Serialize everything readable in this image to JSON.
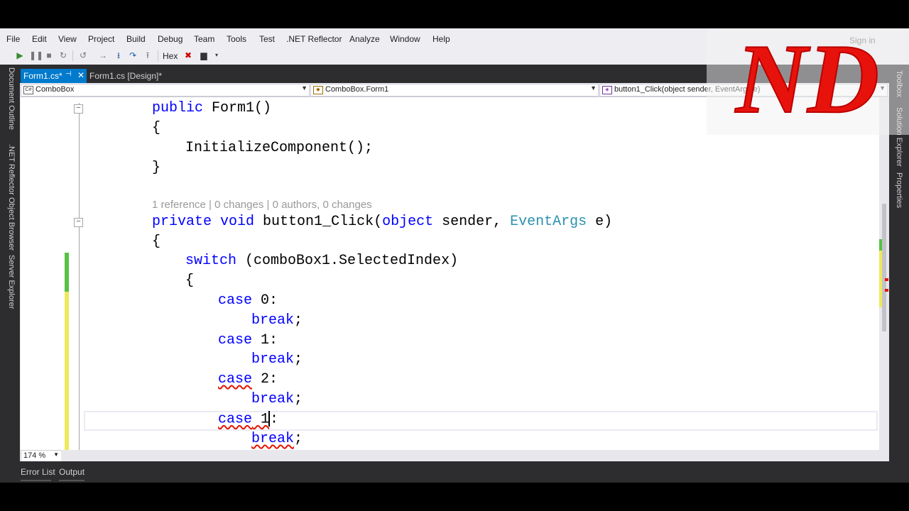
{
  "menu": [
    "File",
    "Edit",
    "View",
    "Project",
    "Build",
    "Debug",
    "Team",
    "Tools",
    "Test",
    ".NET Reflector",
    "Analyze",
    "Window",
    "Help"
  ],
  "account": {
    "signin": "Sign in"
  },
  "toolbar": {
    "hex": "Hex"
  },
  "tabs": {
    "active": "Form1.cs*",
    "inactive": "Form1.cs [Design]*"
  },
  "left_tools": [
    "Document Outline",
    ".NET Reflector Object Browser",
    "Server Explorer"
  ],
  "right_tools": [
    "Toolbox",
    "Solution Explorer",
    "Properties"
  ],
  "navbar": {
    "project": "ComboBox",
    "class": "ComboBox.Form1",
    "member": "button1_Click(object sender, EventArgs e)"
  },
  "code": {
    "l1_kw": "public",
    "l1_rest": " Form1()",
    "l2": "{",
    "l3": "InitializeComponent();",
    "l4": "}",
    "codelens": "1 reference | 0 changes | 0 authors, 0 changes",
    "l5_kw1": "private",
    "l5_kw2": "void",
    "l5_mid": " button1_Click(",
    "l5_kw3": "object",
    "l5_mid2": " sender, ",
    "l5_type": "EventArgs",
    "l5_end": " e)",
    "l6": "{",
    "l7_kw": "switch",
    "l7_rest": " (comboBox1.SelectedIndex)",
    "l8": "{",
    "case_kw": "case",
    "case0": " 0:",
    "case1": " 1:",
    "case2": " 2:",
    "case3_num": " 1",
    "case3_colon": ":",
    "break_kw": "break",
    "semi": ";"
  },
  "zoom": "174 %",
  "bottom_tabs": [
    "Error List",
    "Output"
  ],
  "watermark": "ND",
  "colors": {
    "accent": "#007acc",
    "keyword": "#0000ff",
    "type": "#2b91af",
    "watermark": "#e8120c"
  }
}
